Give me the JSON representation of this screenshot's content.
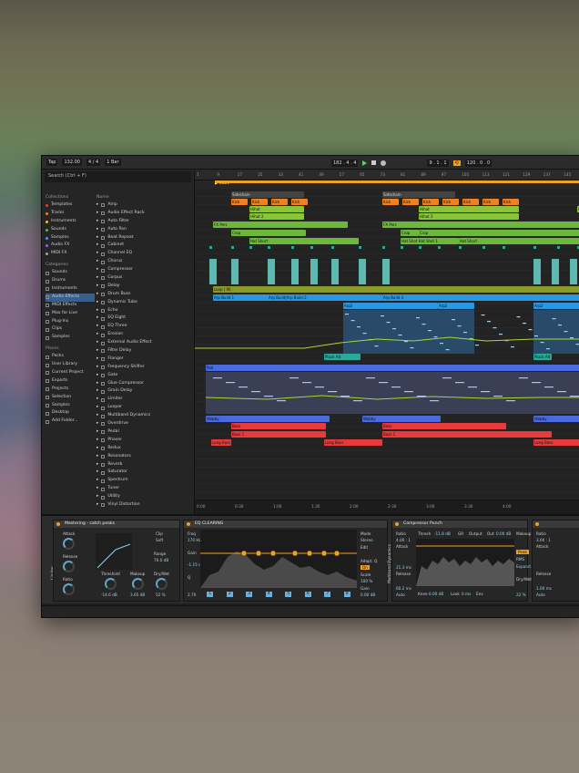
{
  "transport": {
    "tap": "Tap",
    "tempo": "132.00",
    "sig": "4 / 4",
    "quant": "1 Bar",
    "position": "182 . 4 . 4",
    "loop_start": "9 . 1 . 1",
    "loop_len": "120 . 0 . 0"
  },
  "browser": {
    "search_placeholder": "Search (Ctrl + F)",
    "collections_header": "Collections",
    "collections": [
      {
        "label": "Templates",
        "color": "#e04040"
      },
      {
        "label": "Tracks",
        "color": "#f08020"
      },
      {
        "label": "Instruments",
        "color": "#f0c020"
      },
      {
        "label": "Sounds",
        "color": "#40c060"
      },
      {
        "label": "Samples",
        "color": "#40a0f0"
      },
      {
        "label": "Audio FX",
        "color": "#a060e0"
      },
      {
        "label": "MIDI FX",
        "color": "#a0a0a0"
      }
    ],
    "categories_header": "Categories",
    "categories": [
      "Sounds",
      "Drums",
      "Instruments",
      "Audio Effects",
      "MIDI Effects",
      "Max for Live",
      "Plug-Ins",
      "Clips",
      "Samples"
    ],
    "places_header": "Places",
    "places": [
      "Packs",
      "User Library",
      "Current Project",
      "Exports",
      "Projects",
      "Selection",
      "Samples",
      "Desktop",
      "Add Folder..."
    ],
    "name_header": "Name",
    "effects": [
      "Amp",
      "Audio Effect Rack",
      "Auto Filter",
      "Auto Pan",
      "Beat Repeat",
      "Cabinet",
      "Channel EQ",
      "Chorus",
      "Compressor",
      "Corpus",
      "Delay",
      "Drum Buss",
      "Dynamic Tube",
      "Echo",
      "EQ Eight",
      "EQ Three",
      "Erosion",
      "External Audio Effect",
      "Filter Delay",
      "Flanger",
      "Frequency Shifter",
      "Gate",
      "Glue Compressor",
      "Grain Delay",
      "Limiter",
      "Looper",
      "Multiband Dynamics",
      "Overdrive",
      "Pedal",
      "Phaser",
      "Redux",
      "Resonators",
      "Reverb",
      "Saturator",
      "Spectrum",
      "Tuner",
      "Utility",
      "Vinyl Distortion"
    ]
  },
  "ruler": [
    "1",
    "9",
    "17",
    "25",
    "33",
    "41",
    "49",
    "57",
    "65",
    "73",
    "81",
    "89",
    "97",
    "105",
    "113",
    "121",
    "129",
    "137",
    "145",
    "153"
  ],
  "start_marker": "Start",
  "clips": {
    "sidechain": "Sidechain",
    "kick": "Kick",
    "hihat": "Hihat",
    "hihat2": "Hihat 2",
    "fx_perc": "FX Perc",
    "perc": "Perc",
    "clap": "Clap",
    "crop": "Crop",
    "hat_shot": "Hat Short",
    "hat_shot1": "Hat Shot Hat Shot 1",
    "loop": "Loop | 90",
    "arp_build": "Arp Build 1",
    "arp_build_dupe": "Arp Build|Arp Build 2",
    "arp_build4": "Arp Build 4",
    "arp2": "Arp2",
    "pluck": "Pluck Alt",
    "pad": "Pad",
    "wobby": "Wobby",
    "bass": "Bass",
    "bass1": "Bass 1",
    "long_bass": "Long Bass"
  },
  "timebar": [
    "0:00",
    "0:30",
    "1:00",
    "1:30",
    "2:00",
    "2:30",
    "3:00",
    "3:30",
    "4:00"
  ],
  "devices": {
    "mastering": {
      "title": "Mastering - catch peaks",
      "attack": "Attack",
      "release": "Release",
      "ratio": "Ratio",
      "threshold": "Threshold",
      "threshold_val": "-14.6 dB",
      "makeup": "Makeup",
      "makeup_val": "3.65 dB",
      "clip": "Clip",
      "soft": "Soft",
      "range": "Range",
      "range_val": "70.0 dB",
      "drywet": "Dry/Wet",
      "drywet_val": "52 %"
    },
    "eq": {
      "title": "EQ CLEARING",
      "freq": "Freq",
      "freq_val": "170 Hz",
      "gain": "Gain",
      "gain_val": "-1.15 dB",
      "q": "Q",
      "q_val": "2.70",
      "mode": "Mode",
      "mode_val": "Stereo",
      "edit": "Edit",
      "adapt_q": "Adapt. Q",
      "on": "On",
      "scale": "Scale",
      "scale_val": "100 %",
      "gain2": "Gain",
      "gain2_val": "0.00 dB",
      "bands": [
        "1",
        "2",
        "3",
        "4",
        "5",
        "6",
        "7",
        "8"
      ]
    },
    "comp": {
      "title": "Compressor Punch",
      "ratio": "Ratio",
      "ratio_val": "4.00 : 1",
      "attack": "Attack",
      "attack_val": "21.3 ms",
      "release": "Release",
      "release_val": "60.2 ms",
      "auto": "Auto",
      "thresh": "Thresh",
      "thresh_val": "-11.8 dB",
      "gr": "GR",
      "output": "Output",
      "out": "Out",
      "out_val": "0.00 dB",
      "makeup": "Makeup",
      "peak": "Peak",
      "rms": "RMS",
      "expand": "Expand",
      "knee": "Knee",
      "knee_val": "6.00 dB",
      "look": "Look",
      "look_val": "0 ms",
      "env": "Env",
      "drywet": "Dry/Wet",
      "drywet_val": "22 %",
      "makeup_val": "5.39 dB"
    },
    "comp2": {
      "ratio": "Ratio",
      "ratio_val": "3.00 : 1",
      "attack": "Attack",
      "release": "Release",
      "release_val": "1.00 ms",
      "auto": "Auto"
    },
    "limiter_label": "Limiter",
    "multiband_label": "Multiband Dynamics"
  }
}
